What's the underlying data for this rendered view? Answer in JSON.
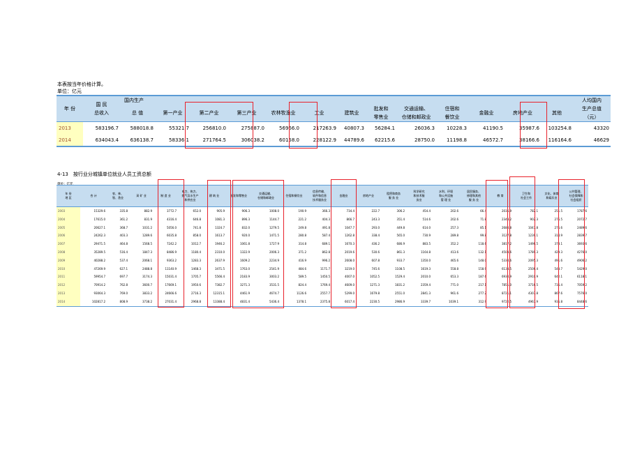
{
  "table1": {
    "note": "本表按当年价格计算。",
    "unit": "单位：亿元",
    "headers": {
      "year": "年 份",
      "gni": "国 民\n总收入",
      "gdp_total_top": "国内生产",
      "gdp_total": "总 值",
      "primary": "第一产业",
      "secondary": "第二产业",
      "tertiary": "第三产业",
      "agri": "农林牧渔业",
      "industry": "工业",
      "construction": "建筑业",
      "wholesale": "批发和\n零售业",
      "transport": "交通运输、\n仓储和邮政业",
      "hotel": "住宿和\n餐饮业",
      "finance": "金融业",
      "realestate": "房地产业",
      "other": "其他",
      "percapita": "人均国内\n生产总值\n（元）"
    },
    "rows": [
      {
        "year": "2013",
        "gni": "583196.7",
        "gdp": "588018.8",
        "primary": "55321.7",
        "secondary": "256810.0",
        "tertiary": "275887.0",
        "agri": "56966.0",
        "industry": "217263.9",
        "construction": "40807.3",
        "wholesale": "56284.1",
        "transport": "26036.3",
        "hotel": "10228.3",
        "finance": "41190.5",
        "realestate": "35987.6",
        "other": "103254.8",
        "percapita": "43320"
      },
      {
        "year": "2014",
        "gni": "634043.4",
        "gdp": "636138.7",
        "primary": "58336.1",
        "secondary": "271764.5",
        "tertiary": "306038.2",
        "agri": "60158.0",
        "industry": "228122.9",
        "construction": "44789.6",
        "wholesale": "62215.6",
        "transport": "28750.0",
        "hotel": "11198.8",
        "finance": "46572.7",
        "realestate": "38166.6",
        "other": "116164.6",
        "percapita": "46629"
      }
    ]
  },
  "table2": {
    "title": "4-13　按行业分城镇单位就业人员工资总额",
    "unit": "单位：亿元",
    "headers": [
      "年 份\n地 区",
      "合 计",
      "农、林、\n牧、渔业",
      "采 矿 业",
      "制 造 业",
      "电力、热力、\n燃气及水生产\n和供应业",
      "建 筑 业",
      "批发和零售业",
      "交通运输、\n仓储和邮政业",
      "住宿和餐饮业",
      "信息传输、\n软件和信息\n技术服务业",
      "金融业",
      "房地产业",
      "租赁和商务\n服 务 业",
      "科学研究\n和技术服\n务业",
      "水利、环境\n和公共设施\n管 理 业",
      "居民服务、\n修理和其他\n服 务 业",
      "教 育",
      "卫生和\n社会工作",
      "文化、体育\n和娱乐业",
      "公共管理、\n社会保障和\n社会组织"
    ],
    "rows": [
      [
        "2003",
        "15329.6",
        "335.8",
        "882.9",
        "3772.7",
        "652.0",
        "905.9",
        "906.3",
        "1008.0",
        "190.9",
        "366.3",
        "734.4",
        "222.7",
        "306.2",
        "454.4",
        "202.6",
        "66.4",
        "2036.9",
        "782.1",
        "251.5",
        "1787.6"
      ],
      [
        "2004",
        "17615.0",
        "361.2",
        "831.9",
        "4316.4",
        "646.8",
        "1081.3",
        "896.3",
        "1144.7",
        "221.2",
        "404.3",
        "866.7",
        "243.3",
        "351.4",
        "514.6",
        "202.6",
        "71.8",
        "2348.2",
        "902.3",
        "275.5",
        "2072.7"
      ],
      [
        "2005",
        "20627.1",
        "368.7",
        "1031.2",
        "5056.0",
        "741.8",
        "1324.7",
        "832.0",
        "1279.5",
        "249.8",
        "491.8",
        "1047.7",
        "293.0",
        "449.8",
        "614.0",
        "257.3",
        "85.1",
        "2680.8",
        "1047.8",
        "275.6",
        "2489.6"
      ],
      [
        "2006",
        "24262.3",
        "403.3",
        "1289.6",
        "6035.8",
        "858.0",
        "1613.7",
        "920.0",
        "1471.5",
        "280.8",
        "587.4",
        "1262.8",
        "338.4",
        "565.0",
        "730.9",
        "289.8",
        "99.8",
        "3127.8",
        "1239.1",
        "314.9",
        "2839.7"
      ],
      [
        "2007",
        "29471.5",
        "464.8",
        "1568.5",
        "7242.2",
        "1012.7",
        "1946.2",
        "1061.8",
        "1727.9",
        "314.8",
        "689.1",
        "1670.3",
        "436.2",
        "686.9",
        "883.5",
        "352.2",
        "118.6",
        "3817.2",
        "1496.5",
        "378.1",
        "3693.6"
      ],
      [
        "2008",
        "35289.5",
        "516.4",
        "1847.3",
        "8486.9",
        "1180.4",
        "2310.0",
        "1322.9",
        "2006.3",
        "371.2",
        "862.8",
        "2019.6",
        "530.6",
        "861.3",
        "1164.8",
        "413.6",
        "132.1",
        "4503.6",
        "1789.3",
        "429.3",
        "4276.0"
      ],
      [
        "2009",
        "40288.2",
        "537.4",
        "2068.1",
        "9363.2",
        "1283.3",
        "2637.9",
        "1609.2",
        "2234.9",
        "416.9",
        "996.2",
        "2608.0",
        "607.8",
        "933.7",
        "1350.0",
        "465.6",
        "148.0",
        "5330.6",
        "2095.3",
        "491.6",
        "4906.2"
      ],
      [
        "2010",
        "47269.9",
        "627.1",
        "2488.8",
        "11140.9",
        "1468.3",
        "3471.5",
        "1763.0",
        "2541.9",
        "484.6",
        "1171.7",
        "3219.0",
        "745.6",
        "1108.5",
        "1619.3",
        "558.8",
        "158.9",
        "6138.5",
        "2506.4",
        "543.7",
        "5429.0"
      ],
      [
        "2011",
        "59954.7",
        "697.7",
        "3174.3",
        "15031.4",
        "1705.7",
        "5566.4",
        "2183.9",
        "3003.2",
        "589.5",
        "1450.5",
        "4007.0",
        "1052.5",
        "1529.4",
        "2010.0",
        "653.3",
        "187.6",
        "6930.9",
        "2910.9",
        "642.1",
        "6118.1"
      ],
      [
        "2012",
        "70914.2",
        "762.8",
        "3600.7",
        "17669.1",
        "1950.6",
        "7382.7",
        "3271.3",
        "3531.5",
        "824.4",
        "1769.4",
        "4609.0",
        "1271.3",
        "1831.2",
        "2359.4",
        "771.0",
        "217.1",
        "7851.0",
        "3716.5",
        "735.4",
        "7059.2"
      ],
      [
        "2013",
        "93064.3",
        "769.0",
        "3833.2",
        "24666.6",
        "2716.3",
        "12315.1",
        "4461.9",
        "4674.7",
        "1126.6",
        "2557.7",
        "5299.0",
        "1679.8",
        "2551.0",
        "2841.3",
        "961.6",
        "277.2",
        "8721.1",
        "4307.8",
        "867.6",
        "7576.0"
      ],
      [
        "2014",
        "102817.2",
        "808.9",
        "3738.2",
        "27031.4",
        "2968.8",
        "13388.4",
        "4831.4",
        "5436.4",
        "1378.1",
        "2375.8",
        "6017.4",
        "2230.5",
        "2986.9",
        "3339.7",
        "1039.1",
        "312.9",
        "9722.5",
        "4967.9",
        "935.8",
        "8448.6"
      ]
    ]
  }
}
